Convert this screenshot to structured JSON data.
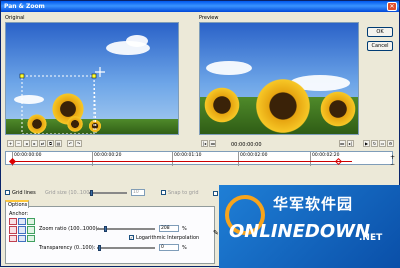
{
  "window": {
    "title": "Pan & Zoom",
    "close_glyph": "✕"
  },
  "original": {
    "label": "Original"
  },
  "preview": {
    "label": "Preview",
    "timecode": "00:00:00:00"
  },
  "buttons": {
    "ok": "OK",
    "cancel": "Cancel"
  },
  "timeline": {
    "ticks": [
      "00:00:00:00",
      "00:00:00:20",
      "00:00:01:10",
      "00:00:02:00",
      "00:00:02:20"
    ]
  },
  "grid": {
    "grid_lines": "Grid lines",
    "grid_size": "Grid size (10..100)",
    "grid_size_value": "10",
    "snap": "Snap to grid"
  },
  "options": {
    "tab": "Options",
    "anchor": "Anchor:",
    "zoom_label": "Zoom ratio (100..1000):",
    "zoom_value": "208",
    "zoom_unit": "%",
    "log": "Logarithmic Interpolation",
    "transparency_label": "Transparency (0..100):",
    "transparency_value": "0",
    "transparency_unit": "%"
  },
  "watermark": {
    "line1": "华军软件园",
    "line2": "ONLINEDOWN",
    "line3": ".NET"
  },
  "colors": {
    "accent": "#0058ee",
    "watermark": "#1f7fd6"
  }
}
